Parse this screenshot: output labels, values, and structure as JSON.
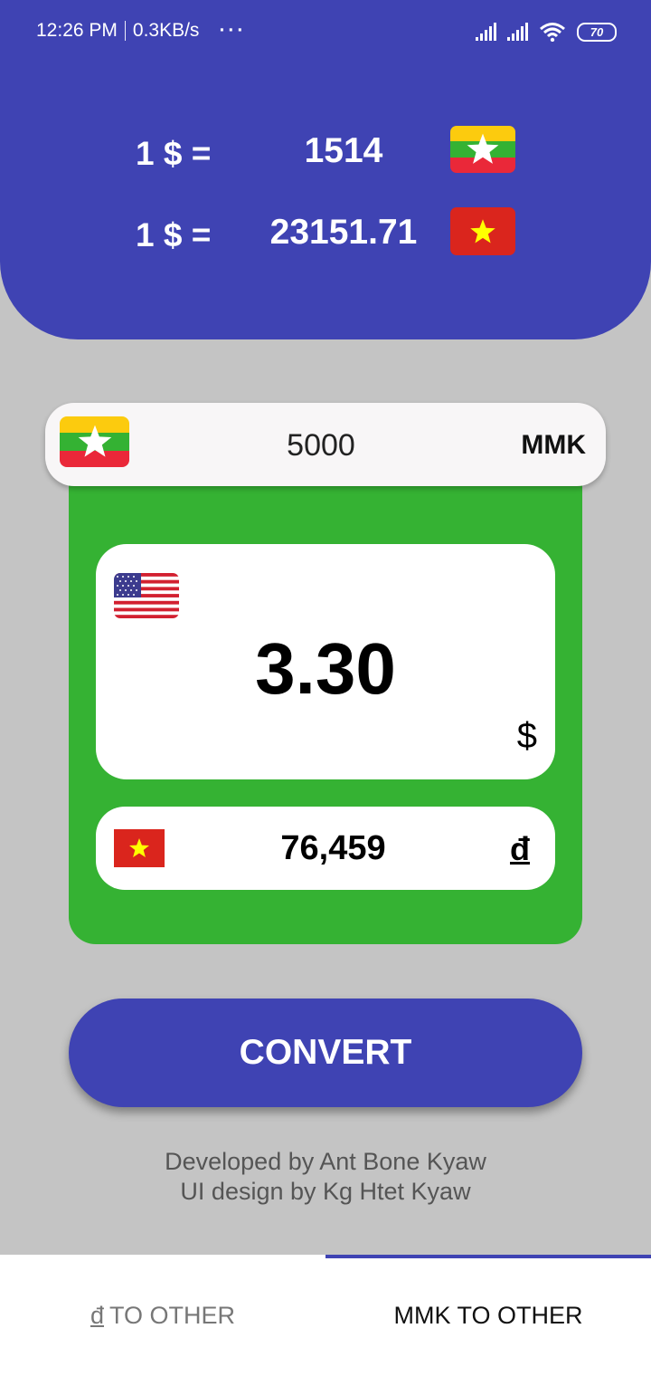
{
  "status_bar": {
    "time": "12:26 PM",
    "speed": "0.3KB/s",
    "dots": "···",
    "battery": "70",
    "icons": [
      "signal-icon",
      "signal-icon",
      "wifi-icon",
      "battery-icon"
    ]
  },
  "rates": [
    {
      "label": "1 $ =",
      "value": "1514",
      "flag": "myanmar-flag-icon"
    },
    {
      "label": "1 $ =",
      "value": "23151.71",
      "flag": "vietnam-flag-icon"
    }
  ],
  "input": {
    "amount": "5000",
    "currency": "MMK",
    "flag": "myanmar-flag-icon"
  },
  "results": {
    "usd": {
      "value": "3.30",
      "symbol": "$",
      "flag": "us-flag-icon"
    },
    "vnd": {
      "value": "76,459",
      "symbol": "đ",
      "flag": "vietnam-flag-icon"
    }
  },
  "convert_label": "CONVERT",
  "credits": {
    "line1": "Developed by Ant Bone Kyaw",
    "line2": "UI design by Kg Htet Kyaw"
  },
  "tabs": [
    {
      "symbol": "đ",
      "label": "TO OTHER",
      "active": false
    },
    {
      "label": "MMK TO OTHER",
      "active": true
    }
  ],
  "colors": {
    "primary": "#3f43b3",
    "green": "#35b233",
    "background": "#c4c4c4"
  }
}
